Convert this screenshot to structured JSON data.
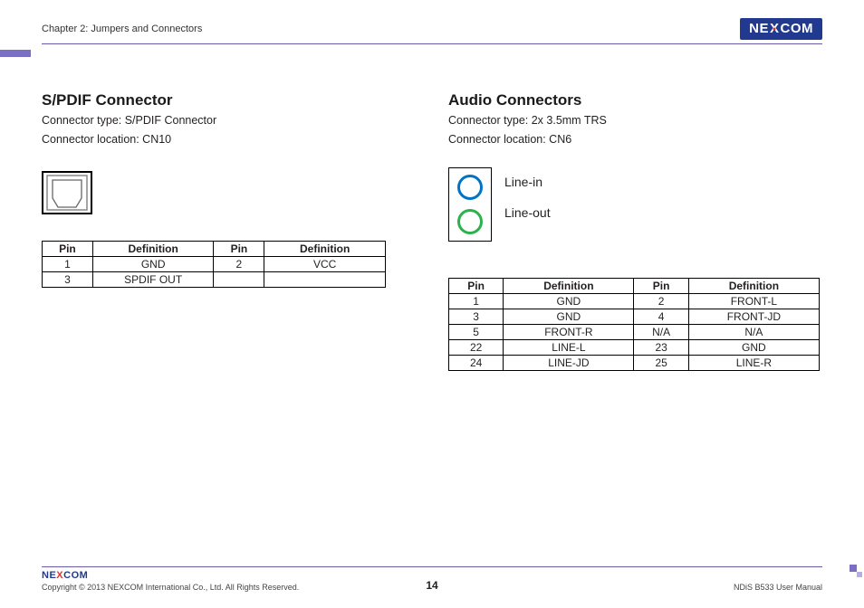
{
  "header": {
    "chapter": "Chapter 2: Jumpers and Connectors",
    "brand_pre": "NE",
    "brand_x": "X",
    "brand_post": "COM"
  },
  "left": {
    "title": "S/PDIF Connector",
    "type_line": "Connector type: S/PDIF Connector",
    "loc_line": "Connector location: CN10",
    "table_hdr_pin": "Pin",
    "table_hdr_def": "Definition",
    "rows": [
      {
        "p1": "1",
        "d1": "GND",
        "p2": "2",
        "d2": "VCC"
      },
      {
        "p1": "3",
        "d1": "SPDIF OUT",
        "p2": "",
        "d2": ""
      }
    ]
  },
  "right": {
    "title": "Audio Connectors",
    "type_line": "Connector type: 2x 3.5mm TRS",
    "loc_line": "Connector location: CN6",
    "line_in": "Line-in",
    "line_out": "Line-out",
    "table_hdr_pin": "Pin",
    "table_hdr_def": "Definition",
    "rows": [
      {
        "p1": "1",
        "d1": "GND",
        "p2": "2",
        "d2": "FRONT-L"
      },
      {
        "p1": "3",
        "d1": "GND",
        "p2": "4",
        "d2": "FRONT-JD"
      },
      {
        "p1": "5",
        "d1": "FRONT-R",
        "p2": "N/A",
        "d2": "N/A"
      },
      {
        "p1": "22",
        "d1": "LINE-L",
        "p2": "23",
        "d2": "GND"
      },
      {
        "p1": "24",
        "d1": "LINE-JD",
        "p2": "25",
        "d2": "LINE-R"
      }
    ]
  },
  "footer": {
    "copyright": "Copyright © 2013 NEXCOM International Co., Ltd. All Rights Reserved.",
    "page": "14",
    "manual": "NDiS B533 User Manual"
  }
}
